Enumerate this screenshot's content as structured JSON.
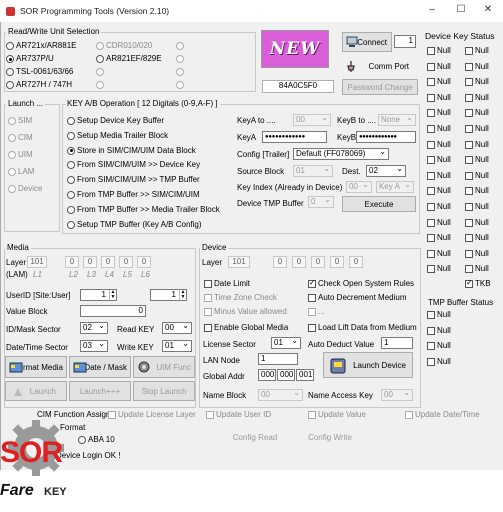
{
  "window": {
    "title": "SOR Programming Tools   (Version 2.10)",
    "minimize": "–",
    "maximize": "☐",
    "close": "✕"
  },
  "rw_group": {
    "label": "Read/Write Unit Selection",
    "options": [
      {
        "label": "AR721x/AR881E",
        "checked": false
      },
      {
        "label": "CDR010/020",
        "checked": false,
        "disabled": true
      },
      {
        "label": "",
        "checked": false,
        "disabled": true
      },
      {
        "label": "AR737P/U",
        "checked": true
      },
      {
        "label": "AR821EF/829E",
        "checked": false
      },
      {
        "label": "",
        "checked": false,
        "disabled": true
      },
      {
        "label": "TSL-0061/63/66",
        "checked": false
      },
      {
        "label": "",
        "checked": false,
        "disabled": true
      },
      {
        "label": "",
        "checked": false,
        "disabled": true
      },
      {
        "label": "AR727H / 747H",
        "checked": false
      },
      {
        "label": "",
        "checked": false,
        "disabled": true
      },
      {
        "label": "",
        "checked": false,
        "disabled": true
      }
    ]
  },
  "new_badge": "NEW",
  "connect": {
    "label": "Connect",
    "port": "1"
  },
  "comm_port_label": "Comm Port",
  "device_id": "84A0C5F0",
  "password_change": "Password Change",
  "device_key_status": {
    "title": "Device Key Status",
    "col1": [
      "Null",
      "Null",
      "Null",
      "Null",
      "Null",
      "Null",
      "Null",
      "Null",
      "Null",
      "Null",
      "Null",
      "Null",
      "Null",
      "Null",
      "Null"
    ],
    "col2": [
      "Null",
      "Null",
      "Null",
      "Null",
      "Null",
      "Null",
      "Null",
      "Null",
      "Null",
      "Null",
      "Null",
      "Null",
      "Null",
      "Null",
      "Null"
    ],
    "tkb": "TKB"
  },
  "tmp_buffer_status": {
    "title": "TMP Buffer Status",
    "items": [
      "Null",
      "Null",
      "Null",
      "Null"
    ]
  },
  "launch_group": {
    "label": "Launch ...",
    "options": [
      "SIM",
      "CIM",
      "UIM",
      "LAM",
      "Device"
    ]
  },
  "key_ab": {
    "label": "KEY A/B Operation  [ 12 Digitals (0-9,A-F) ]",
    "options": [
      {
        "label": "Setup Device Key Buffer",
        "checked": false
      },
      {
        "label": "Setup Media Trailer Block",
        "checked": false
      },
      {
        "label": "Store in SIM/CIM/UIM Data Block",
        "checked": true
      },
      {
        "label": "From SIM/CIM/UIM  >> Device Key",
        "checked": false
      },
      {
        "label": "From SIM/CIM/UIM  >> TMP Buffer",
        "checked": false
      },
      {
        "label": "From TMP Buffer >> SIM/CIM/UIM",
        "checked": false
      },
      {
        "label": "From TMP Buffer >> Media Trailer Block",
        "checked": false
      },
      {
        "label": "Setup TMP Buffer (Key A/B  Config)",
        "checked": false
      }
    ],
    "keya_to_label": "KeyA  to ....",
    "keya_to_value": "00",
    "keyb_to_label": "KeyB  to ....",
    "keyb_to_value": "None",
    "keya_label": "KeyA",
    "keya_value": "●●●●●●●●●●●●",
    "keyb_label": "KeyB",
    "keyb_value": "●●●●●●●●●●●●",
    "config_label": "Config [Trailer]",
    "config_value": "Default (FF078069)",
    "source_block_label": "Source Block",
    "source_block_value": "01",
    "dest_label": "Dest.",
    "dest_value": "02",
    "key_index_label": "Key Index (Already in Device)",
    "key_index_value": "00",
    "key_index_ab": "Key A",
    "device_tmp_label": "Device TMP Buffer",
    "device_tmp_value": "0",
    "execute": "Execute"
  },
  "media": {
    "label": "Media",
    "layer_label": "Layer",
    "layer_values": [
      "101",
      "0",
      "0",
      "0",
      "0",
      "0"
    ],
    "lam_label": "(LAM)",
    "l_labels": [
      "L1",
      "L2",
      "L3",
      "L4",
      "L5",
      "L6"
    ],
    "userid_label": "UserID [Site:User]",
    "userid_site": "1",
    "userid_user": "1",
    "value_block_label": "Value Block",
    "value_block": "0",
    "id_mask_label": "ID/Mask Sector",
    "id_mask_value": "02",
    "read_key_label": "Read KEY",
    "read_key_value": "00",
    "datetime_label": "Date/Time Sector",
    "datetime_value": "03",
    "write_key_label": "Write KEY",
    "write_key_value": "01",
    "format_media": "Format Media",
    "date_mask": "Date / Mask",
    "uim_func": "UIM Func",
    "launch": "Launch",
    "launch_ppp": "Launch+++",
    "stop_launch": "Stop Launch"
  },
  "device": {
    "label": "Device",
    "layer_label": "Layer",
    "layer_values": [
      "101",
      "0",
      "0",
      "0",
      "0",
      "0"
    ],
    "date_limit": "Date Limit",
    "time_zone": "Time Zone Check",
    "minus_value": "Minus Value allowed",
    "check_open": "Check Open System Rules",
    "auto_decrement": "Auto Decrement Medium",
    "ellipsis": "...",
    "enable_global": "Enable Global Media",
    "load_lift": "Load Lift Data from Medium",
    "license_sector_label": "License Sector",
    "license_sector_value": "01",
    "auto_deduct_label": "Auto Deduct Value",
    "auto_deduct_value": "1",
    "lan_node_label": "LAN Node",
    "lan_node_value": "1",
    "global_addr_label": "Global Addr",
    "global_addr": [
      "000",
      "000",
      "001"
    ],
    "launch_device": "Launch Device",
    "name_block_label": "Name Block",
    "name_block_value": "00",
    "name_access_label": "Name Access Key",
    "name_access_value": "00"
  },
  "bottom": {
    "cim_assign": "CIM Function Assign:",
    "update_license": "Update License Layer",
    "update_user": "Update User ID",
    "update_value": "Update Value",
    "update_datetime": "Update Date/Time",
    "format_label": "Format",
    "aba": "ABA 10",
    "config_read": "Config Read",
    "config_write": "Config Write",
    "status": "Device Login OK !"
  },
  "logo": {
    "line1": "SOR",
    "line2": "Fare",
    "key": "KEY"
  },
  "colors": {
    "new_bg": "#d95fd8",
    "logo_red": "#e02020",
    "logo_gray": "#7a7a7a"
  }
}
